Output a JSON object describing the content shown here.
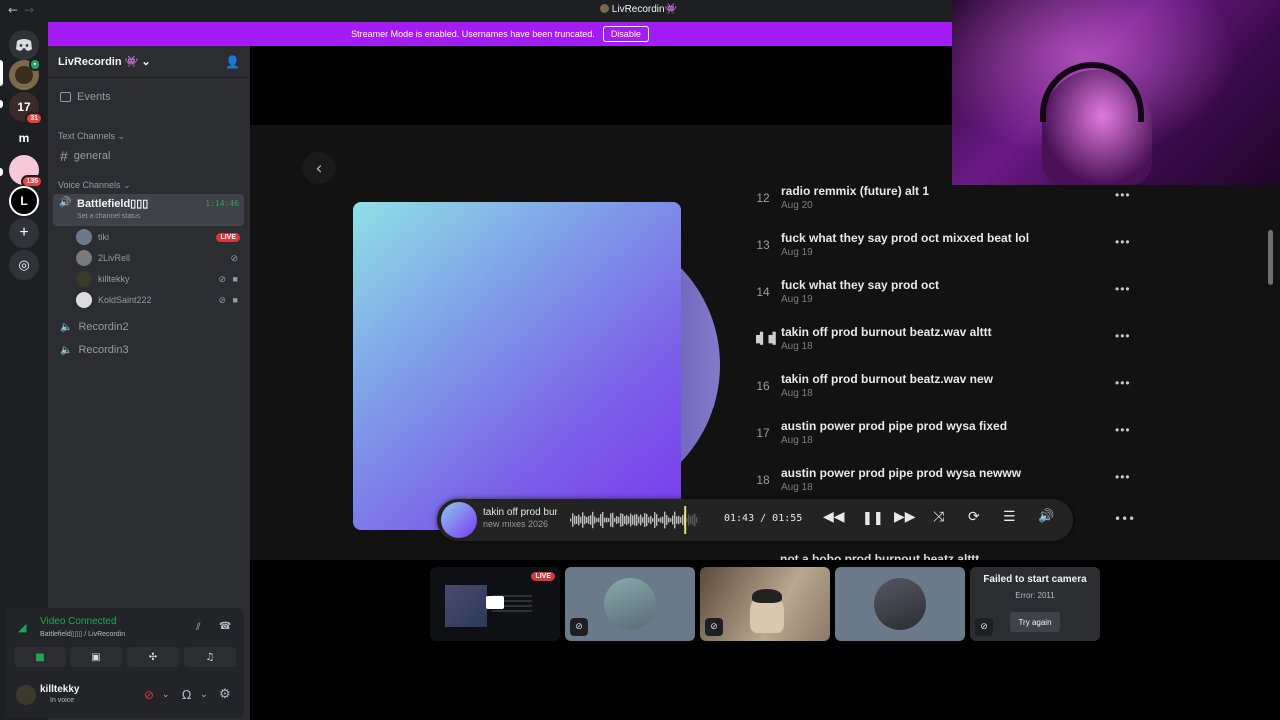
{
  "window": {
    "title": "LivRecordin",
    "title_emoji": "👾"
  },
  "banner": {
    "text": "Streamer Mode is enabled. Usernames have been truncated.",
    "button": "Disable"
  },
  "rail": {
    "servers": [
      {
        "label": "",
        "badge": "",
        "color": "#7b6a4a"
      },
      {
        "label": "17",
        "badge": "31",
        "color": "#3a2a2a"
      },
      {
        "label": "m",
        "badge": "",
        "color": "#1e1f22"
      },
      {
        "label": "",
        "badge": "135",
        "color": "#f7c9d8"
      },
      {
        "label": "L",
        "badge": "",
        "color": "#000000"
      }
    ]
  },
  "sidebar": {
    "server_name": "LivRecordin",
    "server_emoji": "👾",
    "events": "Events",
    "text_category": "Text Channels",
    "text_channels": [
      "general"
    ],
    "voice_category": "Voice Channels",
    "active_voice": {
      "name": "Battlefield▯▯▯",
      "timer": "1:14:46",
      "status": "Set a channel status"
    },
    "voice_users": [
      {
        "name": "tiki",
        "live": "LIVE"
      },
      {
        "name": "2LivRell",
        "live": ""
      },
      {
        "name": "killtekky",
        "live": ""
      },
      {
        "name": "KoldSaint222",
        "live": ""
      }
    ],
    "other_voice": [
      "Recordin2",
      "Recordin3"
    ]
  },
  "voice_panel": {
    "status": "Video Connected",
    "location": "Battlefield▯▯▯ / LivRecordin",
    "user": "killtekky",
    "user_status": "In voice"
  },
  "player": {
    "back": "‹",
    "tracks": [
      {
        "num": "12",
        "title": "radio remmix (future) alt 1",
        "date": "Aug 20"
      },
      {
        "num": "13",
        "title": "fuck what they say prod oct mixxed beat lol",
        "date": "Aug 19"
      },
      {
        "num": "14",
        "title": "fuck what they say prod oct",
        "date": "Aug 19"
      },
      {
        "num": "15",
        "title": "takin off prod burnout beatz.wav alttt",
        "date": "Aug 18"
      },
      {
        "num": "16",
        "title": "takin off prod burnout beatz.wav new",
        "date": "Aug 18"
      },
      {
        "num": "17",
        "title": "austin power prod pipe prod wysa fixed",
        "date": "Aug 18"
      },
      {
        "num": "18",
        "title": "austin power prod pipe prod wysa newww",
        "date": "Aug 18"
      }
    ],
    "next_peek": "not a bobo prod burnout beatz alttt",
    "playing_index": 3,
    "now_playing": {
      "title": "takin off prod burnout beatz.wav alttt",
      "subtitle": "new mixes 2026",
      "elapsed": "01:43",
      "duration": "01:55",
      "progress": 0.9
    }
  },
  "tiles": [
    {
      "kind": "screen",
      "badge": "LIVE"
    },
    {
      "kind": "avatar"
    },
    {
      "kind": "camera"
    },
    {
      "kind": "avatar"
    },
    {
      "kind": "error",
      "title": "Failed to start camera",
      "error": "Error: 2011",
      "button": "Try again"
    }
  ]
}
